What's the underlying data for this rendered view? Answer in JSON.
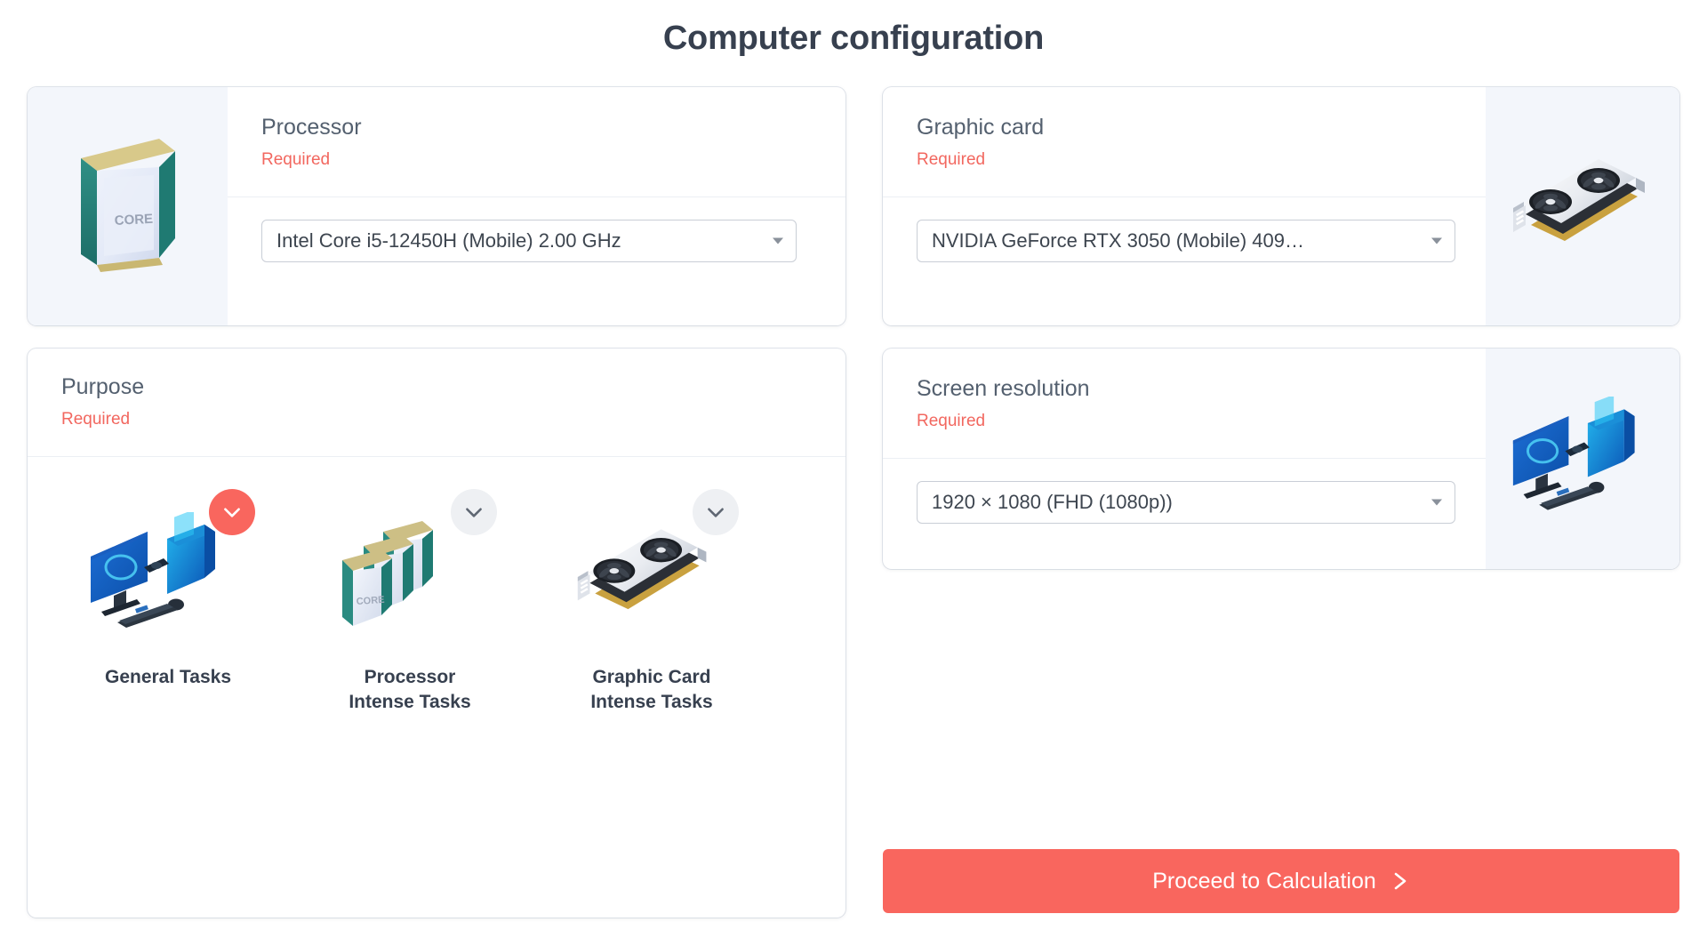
{
  "page": {
    "title": "Computer configuration",
    "accent_color": "#f9665e",
    "title_color": "#37404f",
    "required_color": "#f2675f",
    "card_bg": "#ffffff",
    "image_pane_bg": "#f3f6fb",
    "background": "#ffffff"
  },
  "cards": {
    "processor": {
      "title": "Processor",
      "required_label": "Required",
      "selected_value": "Intel Core i5-12450H (Mobile) 2.00 GHz",
      "image_name": "processor-illustration"
    },
    "graphic_card": {
      "title": "Graphic card",
      "required_label": "Required",
      "selected_value": "NVIDIA GeForce RTX 3050 (Mobile) 409…",
      "image_name": "graphic-card-illustration"
    },
    "purpose": {
      "title": "Purpose",
      "required_label": "Required",
      "options": [
        {
          "label": "General Tasks",
          "selected": true,
          "icon": "desktop-setup-illustration",
          "check_icon": "check-icon"
        },
        {
          "label": "Processor\nIntense Tasks",
          "selected": false,
          "icon": "processor-stack-illustration",
          "check_icon": "check-icon"
        },
        {
          "label": "Graphic Card\nIntense Tasks",
          "selected": false,
          "icon": "graphic-card-illustration",
          "check_icon": "check-icon"
        }
      ]
    },
    "screen_resolution": {
      "title": "Screen resolution",
      "required_label": "Required",
      "selected_value": "1920 × 1080 (FHD (1080p))",
      "image_name": "desktop-setup-illustration"
    }
  },
  "actions": {
    "proceed_label": "Proceed to Calculation",
    "proceed_icon": "chevron-right-icon"
  }
}
